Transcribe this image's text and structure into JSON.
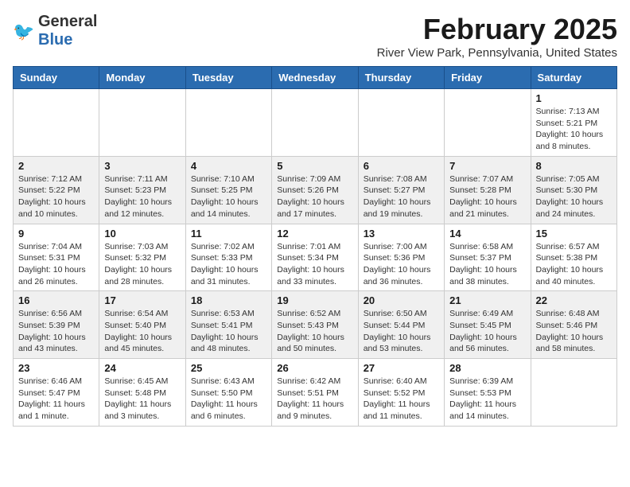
{
  "header": {
    "logo_general": "General",
    "logo_blue": "Blue",
    "title": "February 2025",
    "subtitle": "River View Park, Pennsylvania, United States"
  },
  "days_of_week": [
    "Sunday",
    "Monday",
    "Tuesday",
    "Wednesday",
    "Thursday",
    "Friday",
    "Saturday"
  ],
  "weeks": [
    [
      {
        "day": "",
        "detail": ""
      },
      {
        "day": "",
        "detail": ""
      },
      {
        "day": "",
        "detail": ""
      },
      {
        "day": "",
        "detail": ""
      },
      {
        "day": "",
        "detail": ""
      },
      {
        "day": "",
        "detail": ""
      },
      {
        "day": "1",
        "detail": "Sunrise: 7:13 AM\nSunset: 5:21 PM\nDaylight: 10 hours\nand 8 minutes."
      }
    ],
    [
      {
        "day": "2",
        "detail": "Sunrise: 7:12 AM\nSunset: 5:22 PM\nDaylight: 10 hours\nand 10 minutes."
      },
      {
        "day": "3",
        "detail": "Sunrise: 7:11 AM\nSunset: 5:23 PM\nDaylight: 10 hours\nand 12 minutes."
      },
      {
        "day": "4",
        "detail": "Sunrise: 7:10 AM\nSunset: 5:25 PM\nDaylight: 10 hours\nand 14 minutes."
      },
      {
        "day": "5",
        "detail": "Sunrise: 7:09 AM\nSunset: 5:26 PM\nDaylight: 10 hours\nand 17 minutes."
      },
      {
        "day": "6",
        "detail": "Sunrise: 7:08 AM\nSunset: 5:27 PM\nDaylight: 10 hours\nand 19 minutes."
      },
      {
        "day": "7",
        "detail": "Sunrise: 7:07 AM\nSunset: 5:28 PM\nDaylight: 10 hours\nand 21 minutes."
      },
      {
        "day": "8",
        "detail": "Sunrise: 7:05 AM\nSunset: 5:30 PM\nDaylight: 10 hours\nand 24 minutes."
      }
    ],
    [
      {
        "day": "9",
        "detail": "Sunrise: 7:04 AM\nSunset: 5:31 PM\nDaylight: 10 hours\nand 26 minutes."
      },
      {
        "day": "10",
        "detail": "Sunrise: 7:03 AM\nSunset: 5:32 PM\nDaylight: 10 hours\nand 28 minutes."
      },
      {
        "day": "11",
        "detail": "Sunrise: 7:02 AM\nSunset: 5:33 PM\nDaylight: 10 hours\nand 31 minutes."
      },
      {
        "day": "12",
        "detail": "Sunrise: 7:01 AM\nSunset: 5:34 PM\nDaylight: 10 hours\nand 33 minutes."
      },
      {
        "day": "13",
        "detail": "Sunrise: 7:00 AM\nSunset: 5:36 PM\nDaylight: 10 hours\nand 36 minutes."
      },
      {
        "day": "14",
        "detail": "Sunrise: 6:58 AM\nSunset: 5:37 PM\nDaylight: 10 hours\nand 38 minutes."
      },
      {
        "day": "15",
        "detail": "Sunrise: 6:57 AM\nSunset: 5:38 PM\nDaylight: 10 hours\nand 40 minutes."
      }
    ],
    [
      {
        "day": "16",
        "detail": "Sunrise: 6:56 AM\nSunset: 5:39 PM\nDaylight: 10 hours\nand 43 minutes."
      },
      {
        "day": "17",
        "detail": "Sunrise: 6:54 AM\nSunset: 5:40 PM\nDaylight: 10 hours\nand 45 minutes."
      },
      {
        "day": "18",
        "detail": "Sunrise: 6:53 AM\nSunset: 5:41 PM\nDaylight: 10 hours\nand 48 minutes."
      },
      {
        "day": "19",
        "detail": "Sunrise: 6:52 AM\nSunset: 5:43 PM\nDaylight: 10 hours\nand 50 minutes."
      },
      {
        "day": "20",
        "detail": "Sunrise: 6:50 AM\nSunset: 5:44 PM\nDaylight: 10 hours\nand 53 minutes."
      },
      {
        "day": "21",
        "detail": "Sunrise: 6:49 AM\nSunset: 5:45 PM\nDaylight: 10 hours\nand 56 minutes."
      },
      {
        "day": "22",
        "detail": "Sunrise: 6:48 AM\nSunset: 5:46 PM\nDaylight: 10 hours\nand 58 minutes."
      }
    ],
    [
      {
        "day": "23",
        "detail": "Sunrise: 6:46 AM\nSunset: 5:47 PM\nDaylight: 11 hours\nand 1 minute."
      },
      {
        "day": "24",
        "detail": "Sunrise: 6:45 AM\nSunset: 5:48 PM\nDaylight: 11 hours\nand 3 minutes."
      },
      {
        "day": "25",
        "detail": "Sunrise: 6:43 AM\nSunset: 5:50 PM\nDaylight: 11 hours\nand 6 minutes."
      },
      {
        "day": "26",
        "detail": "Sunrise: 6:42 AM\nSunset: 5:51 PM\nDaylight: 11 hours\nand 9 minutes."
      },
      {
        "day": "27",
        "detail": "Sunrise: 6:40 AM\nSunset: 5:52 PM\nDaylight: 11 hours\nand 11 minutes."
      },
      {
        "day": "28",
        "detail": "Sunrise: 6:39 AM\nSunset: 5:53 PM\nDaylight: 11 hours\nand 14 minutes."
      },
      {
        "day": "",
        "detail": ""
      }
    ]
  ]
}
